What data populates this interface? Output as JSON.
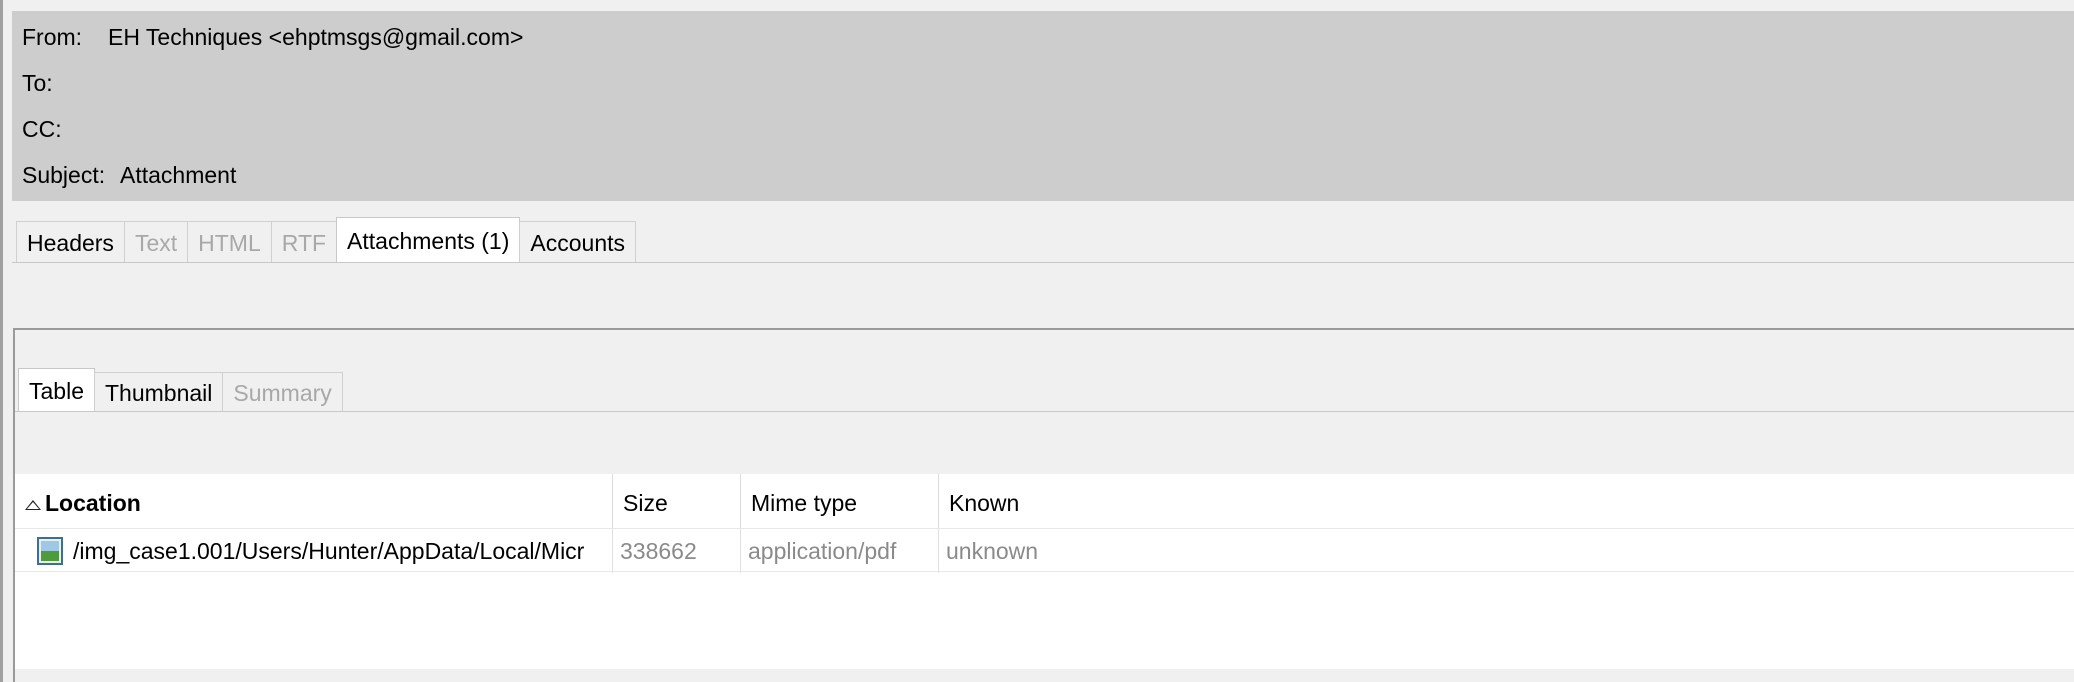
{
  "email_header": {
    "from_label": "From:",
    "from_value": "EH Techniques <ehptmsgs@gmail.com>",
    "to_label": "To:",
    "to_value": "",
    "cc_label": "CC:",
    "cc_value": "",
    "subject_label": "Subject:",
    "subject_value": "Attachment"
  },
  "top_tabs": [
    {
      "label": "Headers",
      "state": "enabled"
    },
    {
      "label": "Text",
      "state": "disabled"
    },
    {
      "label": "HTML",
      "state": "disabled"
    },
    {
      "label": "RTF",
      "state": "disabled"
    },
    {
      "label": "Attachments (1)",
      "state": "active"
    },
    {
      "label": "Accounts",
      "state": "enabled"
    }
  ],
  "view_tabs": [
    {
      "label": "Table",
      "state": "active"
    },
    {
      "label": "Thumbnail",
      "state": "enabled"
    },
    {
      "label": "Summary",
      "state": "disabled"
    }
  ],
  "table": {
    "columns": [
      "Location",
      "Size",
      "Mime type",
      "Known"
    ],
    "sorted_column": "Location",
    "rows": [
      {
        "icon": "image-file-icon",
        "location": "/img_case1.001/Users/Hunter/AppData/Local/Micr",
        "size": "338662",
        "mime_type": "application/pdf",
        "known": "unknown"
      }
    ]
  },
  "colors": {
    "header_panel_bg": "#cdcdcd",
    "window_bg": "#f0f0f0",
    "disabled_text": "#a8a8a8",
    "muted_cell_text": "#8a8a8a"
  }
}
